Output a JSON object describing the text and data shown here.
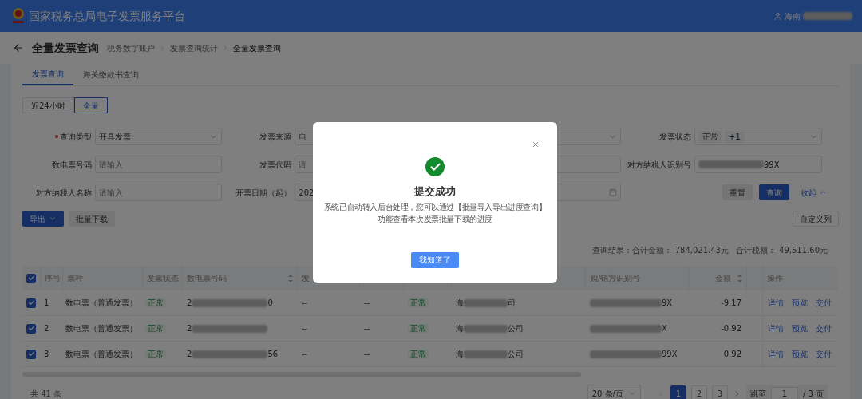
{
  "header": {
    "title": "国家税务总局电子发票服务平台",
    "user": "海南"
  },
  "page": {
    "title": "全量发票查询",
    "breadcrumb": [
      {
        "label": "税务数字账户",
        "current": false
      },
      {
        "label": "发票查询统计",
        "current": false
      },
      {
        "label": "全量发票查询",
        "current": true
      }
    ]
  },
  "tabs": [
    {
      "label": "发票查询",
      "selected": true
    },
    {
      "label": "海关缴款书查询",
      "selected": false
    }
  ],
  "range_toggle": [
    {
      "label": "近24小时",
      "selected": false
    },
    {
      "label": "全量",
      "selected": true
    }
  ],
  "filters": [
    {
      "label": "查询类型",
      "required": true,
      "kind": "select",
      "value": "开具发票"
    },
    {
      "label": "发票来源",
      "kind": "select",
      "value": "电"
    },
    {
      "kind": "select"
    },
    {
      "label": "发票状态",
      "kind": "tags",
      "tags": [
        "正常",
        "+1"
      ]
    },
    {
      "label": "数电票号码",
      "kind": "input",
      "placeholder": "请输入"
    },
    {
      "label": "发票代码",
      "kind": "input",
      "placeholder": "请"
    },
    {
      "kind": "input"
    },
    {
      "label": "对方纳税人识别号",
      "kind": "redacted",
      "value_end": "99X"
    },
    {
      "label": "对方纳税人名称",
      "kind": "input",
      "placeholder": "请输入"
    },
    {
      "label": "开票日期（起）",
      "kind": "input",
      "value": "202"
    },
    {
      "kind": "date"
    }
  ],
  "filter_actions": {
    "reset": "重置",
    "search": "查询",
    "collapse": "收起"
  },
  "toolbar": {
    "export": "导出",
    "batch_download": "批量下载",
    "custom_columns": "自定义列"
  },
  "summary": "查询结果：合计金额：-784,021.43元   合计税额：-49,511.60元",
  "table": {
    "all_checked": true,
    "columns": [
      {
        "label": "序号"
      },
      {
        "label": "票种"
      },
      {
        "label": "发票状态"
      },
      {
        "label": "数电票号码",
        "sortable": true
      },
      {
        "label": "发"
      },
      null,
      null,
      null,
      {
        "label": "购/销方识别号"
      },
      {
        "label": "金额",
        "sortable": true
      },
      null,
      {
        "label": "操作"
      }
    ],
    "rows": [
      {
        "checked": true,
        "seq": "1",
        "type": "数电票（普通发票）",
        "status": "正常",
        "invoice_no": {
          "start": "2",
          "end": "0"
        },
        "column_5": "--",
        "column_6": "--",
        "column_7": "正常",
        "name": {
          "start": "海",
          "end": "司"
        },
        "tax_id": {
          "end": "9X"
        },
        "amount": "-9.17",
        "actions": [
          "详情",
          "预览",
          "交付"
        ]
      },
      {
        "checked": true,
        "seq": "2",
        "type": "数电票（普通发票）",
        "status": "正常",
        "invoice_no": {
          "start": "2"
        },
        "column_5": "--",
        "column_6": "--",
        "column_7": "正常",
        "name": {
          "start": "海",
          "end": "公司"
        },
        "tax_id": {
          "end": "X"
        },
        "amount": "-0.92",
        "actions": [
          "详情",
          "预览",
          "交付"
        ]
      },
      {
        "checked": true,
        "seq": "3",
        "type": "数电票（普通发票）",
        "status": "正常",
        "invoice_no": {
          "start": "2",
          "end": "56"
        },
        "column_5": "--",
        "column_6": "--",
        "column_7": "正常",
        "name": {
          "start": "海",
          "end": "公司"
        },
        "tax_id": {
          "end": "99X"
        },
        "amount": "0.92",
        "actions": [
          "详情",
          "预览",
          "交付"
        ]
      }
    ]
  },
  "pagination": {
    "total": "共 41 条",
    "page_size": "20 条/页",
    "pages": [
      {
        "label": "1",
        "selected": true
      },
      {
        "label": "2",
        "selected": false
      },
      {
        "label": "3",
        "selected": false
      }
    ],
    "jump_label": "跳至",
    "jump_value": "1",
    "page_count": "/ 3 页"
  },
  "modal": {
    "title": "提交成功",
    "message_lines": [
      "系统已自动转入后台处理，您可以通过【批量导入导出进度查询】",
      "功能查看本次发票批量下载的进度"
    ],
    "button": "我知道了"
  }
}
